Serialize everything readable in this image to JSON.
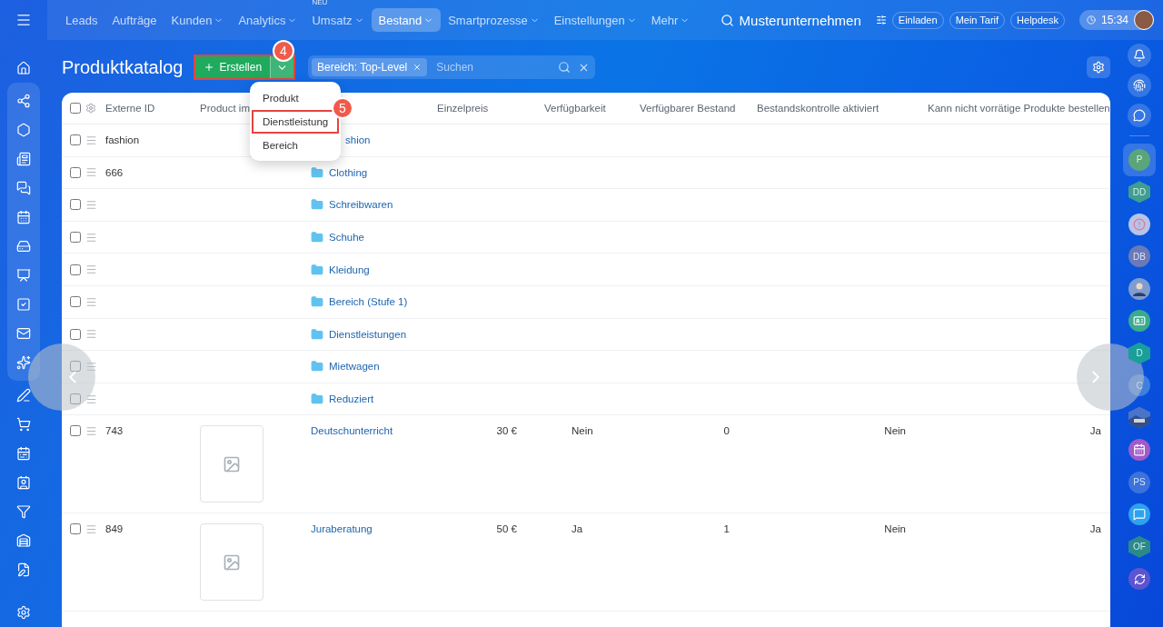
{
  "left_sidebar": {
    "items": [
      {
        "kind": "home",
        "grouped": false
      },
      {
        "kind": "share",
        "grouped": true
      },
      {
        "kind": "hexagon",
        "grouped": true
      },
      {
        "kind": "news",
        "grouped": true
      },
      {
        "kind": "chat",
        "grouped": true
      },
      {
        "kind": "calendar",
        "grouped": true
      },
      {
        "kind": "drive",
        "grouped": true
      },
      {
        "kind": "presentation",
        "grouped": true
      },
      {
        "kind": "task",
        "grouped": true
      },
      {
        "kind": "mail",
        "grouped": true
      },
      {
        "kind": "sparkle",
        "grouped": true
      },
      {
        "kind": "pen",
        "grouped": false
      },
      {
        "kind": "cart",
        "grouped": false
      },
      {
        "kind": "schedule",
        "grouped": false
      },
      {
        "kind": "contact",
        "grouped": false
      },
      {
        "kind": "funnel",
        "grouped": false
      },
      {
        "kind": "warehouse",
        "grouped": false
      },
      {
        "kind": "document",
        "grouped": false
      },
      {
        "kind": "settings",
        "grouped": false
      }
    ]
  },
  "top_nav": {
    "items": [
      {
        "label": "Leads",
        "dropdown": false,
        "selected": false
      },
      {
        "label": "Aufträge",
        "dropdown": false,
        "selected": false
      },
      {
        "label": "Kunden",
        "dropdown": true,
        "selected": false
      },
      {
        "label": "Analytics",
        "dropdown": true,
        "selected": false
      },
      {
        "label": "Umsatz",
        "dropdown": true,
        "selected": false,
        "badge": "NEU"
      },
      {
        "label": "Bestand",
        "dropdown": true,
        "selected": true
      },
      {
        "label": "Smartprozesse",
        "dropdown": true,
        "selected": false
      },
      {
        "label": "Einstellungen",
        "dropdown": true,
        "selected": false
      },
      {
        "label": "Mehr",
        "dropdown": true,
        "selected": false
      }
    ],
    "company": "Musterunternehmen",
    "buttons": [
      "Einladen",
      "Mein Tarif",
      "Helpdesk"
    ],
    "time": "15:34"
  },
  "page": {
    "title": "Produktkatalog",
    "create_button": {
      "label": "Erstellen",
      "highlighted": true,
      "step": "4"
    },
    "filter": {
      "tag": "Bereich: Top-Level",
      "placeholder": "Suchen"
    },
    "create_menu": [
      {
        "label": "Produkt",
        "highlighted": false
      },
      {
        "label": "Dienstleistung",
        "highlighted": true,
        "step": "5"
      },
      {
        "label": "Bereich",
        "highlighted": false
      }
    ]
  },
  "table": {
    "all_checked": false,
    "columns": [
      "Externe ID",
      "Product im",
      "Einzelpreis",
      "Verfügbarkeit",
      "Verfügbarer Bestand",
      "Bestandskontrolle aktiviert",
      "Kann nicht vorrätige Produkte bestellen"
    ],
    "rows": [
      {
        "kind": "covered_section",
        "checked": false,
        "external_id": "fashion",
        "name": "shion"
      },
      {
        "kind": "section",
        "checked": false,
        "external_id": "666",
        "name": "Clothing"
      },
      {
        "kind": "section",
        "checked": false,
        "name": "Schreibwaren"
      },
      {
        "kind": "section",
        "checked": false,
        "name": "Schuhe"
      },
      {
        "kind": "section",
        "checked": false,
        "name": "Kleidung"
      },
      {
        "kind": "section",
        "checked": false,
        "name": "Bereich (Stufe 1)"
      },
      {
        "kind": "section",
        "checked": false,
        "name": "Dienstleistungen"
      },
      {
        "kind": "section",
        "checked": false,
        "name": "Mietwagen"
      },
      {
        "kind": "section",
        "checked": false,
        "name": "Reduziert"
      },
      {
        "kind": "product",
        "checked": false,
        "external_id": "743",
        "name": "Deutschunterricht",
        "price": "30 €",
        "availability": "Nein",
        "stock": "0",
        "stock_control": "Nein",
        "backorder": "Ja"
      },
      {
        "kind": "product",
        "checked": false,
        "external_id": "849",
        "name": "Juraberatung",
        "price": "50 €",
        "availability": "Ja",
        "stock": "1",
        "stock_control": "Nein",
        "backorder": "Ja"
      }
    ]
  },
  "right_sidebar": {
    "items": [
      {
        "kind": "initials",
        "text": "P",
        "color": "#5aa57a",
        "selected": true
      },
      {
        "kind": "hex_initials",
        "text": "DD",
        "color": "#3e9e8f",
        "selected": false
      },
      {
        "kind": "alert",
        "color": "#b7c4e8",
        "selected": false
      },
      {
        "kind": "initials",
        "text": "DB",
        "color": "#6a7ab8",
        "selected": false
      },
      {
        "kind": "person",
        "color": "#7f9ccf",
        "selected": false
      },
      {
        "kind": "card",
        "color": "#3aab8e",
        "selected": false
      },
      {
        "kind": "hex_initials",
        "text": "D",
        "color": "#1a9e9a",
        "selected": false
      },
      {
        "kind": "initials",
        "text": "C",
        "color": "#3f7fe0",
        "selected": false
      },
      {
        "kind": "picture",
        "color": "#4b74c8",
        "selected": false
      },
      {
        "kind": "calendar",
        "color": "#a05bc8",
        "selected": false
      },
      {
        "kind": "initials",
        "text": "PS",
        "color": "#3b72dc",
        "selected": false
      },
      {
        "kind": "chat",
        "color": "#2ea1ef",
        "selected": false
      },
      {
        "kind": "hex_initials",
        "text": "OF",
        "color": "#2a8a8a",
        "selected": false
      },
      {
        "kind": "swirl",
        "color": "#5d55d0",
        "selected": false
      }
    ]
  }
}
